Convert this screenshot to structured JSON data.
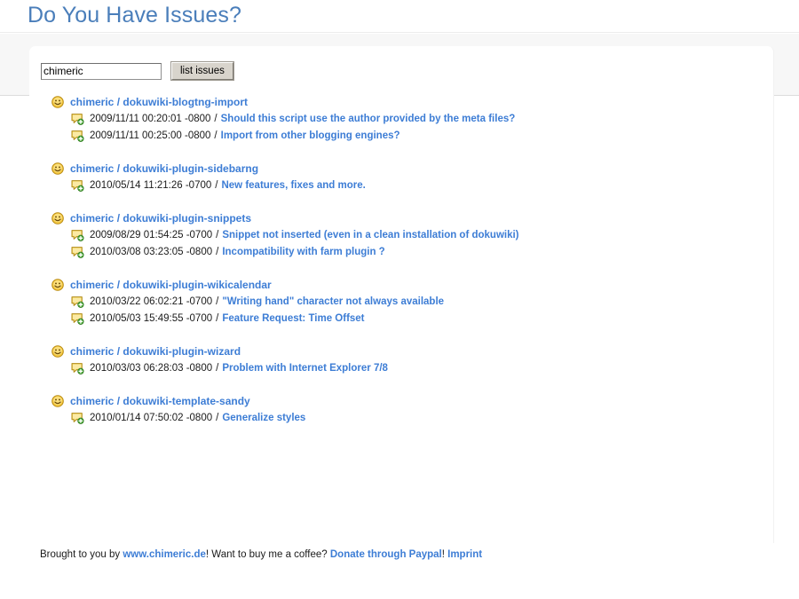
{
  "page": {
    "title": "Do You Have Issues?"
  },
  "search": {
    "value": "chimeric",
    "placeholder": "",
    "button_label": "list issues"
  },
  "icons": {
    "repo": "smiley-icon",
    "issue": "comment-add-icon"
  },
  "colors": {
    "link": "#3d7dd5",
    "title": "#4a7eba",
    "page_bg": "#ffffff",
    "band_bg": "#f7f7f7"
  },
  "repos": [
    {
      "owner": "chimeric",
      "separator": "/",
      "name": "dokuwiki-blogtng-import",
      "issues": [
        {
          "date": "2009/11/11 00:20:01 -0800",
          "separator": "/",
          "title": "Should this script use the author provided by the meta files?"
        },
        {
          "date": "2009/11/11 00:25:00 -0800",
          "separator": "/",
          "title": "Import from other blogging engines?"
        }
      ]
    },
    {
      "owner": "chimeric",
      "separator": "/",
      "name": "dokuwiki-plugin-sidebarng",
      "issues": [
        {
          "date": "2010/05/14 11:21:26 -0700",
          "separator": "/",
          "title": "New features, fixes and more."
        }
      ]
    },
    {
      "owner": "chimeric",
      "separator": "/",
      "name": "dokuwiki-plugin-snippets",
      "issues": [
        {
          "date": "2009/08/29 01:54:25 -0700",
          "separator": "/",
          "title": "Snippet not inserted (even in a clean installation of dokuwiki)"
        },
        {
          "date": "2010/03/08 03:23:05 -0800",
          "separator": "/",
          "title": "Incompatibility with farm plugin ?"
        }
      ]
    },
    {
      "owner": "chimeric",
      "separator": "/",
      "name": "dokuwiki-plugin-wikicalendar",
      "issues": [
        {
          "date": "2010/03/22 06:02:21 -0700",
          "separator": "/",
          "title": "\"Writing hand\" character not always available"
        },
        {
          "date": "2010/05/03 15:49:55 -0700",
          "separator": "/",
          "title": "Feature Request: Time Offset"
        }
      ]
    },
    {
      "owner": "chimeric",
      "separator": "/",
      "name": "dokuwiki-plugin-wizard",
      "issues": [
        {
          "date": "2010/03/03 06:28:03 -0800",
          "separator": "/",
          "title": "Problem with Internet Explorer 7/8"
        }
      ]
    },
    {
      "owner": "chimeric",
      "separator": "/",
      "name": "dokuwiki-template-sandy",
      "issues": [
        {
          "date": "2010/01/14 07:50:02 -0800",
          "separator": "/",
          "title": "Generalize styles"
        }
      ]
    }
  ],
  "footer": {
    "text_before": "Brought to you by ",
    "site_link": "www.chimeric.de",
    "text_middle": "! Want to buy me a coffee? ",
    "donate_link": "Donate through Paypal",
    "text_after": "! ",
    "imprint_link": "Imprint"
  }
}
